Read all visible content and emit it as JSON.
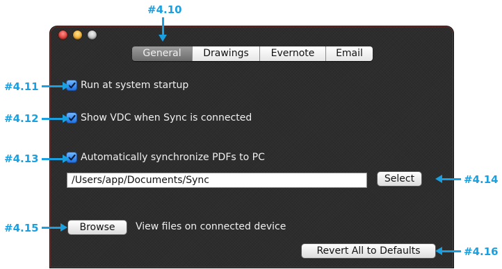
{
  "window": {
    "controls": [
      "close-icon",
      "minimize-icon",
      "zoom-icon"
    ]
  },
  "tabs": [
    {
      "label": "General",
      "active": true
    },
    {
      "label": "Drawings",
      "active": false
    },
    {
      "label": "Evernote",
      "active": false
    },
    {
      "label": "Email",
      "active": false
    }
  ],
  "settings": {
    "run_at_startup": {
      "label": "Run at system startup",
      "checked": true
    },
    "show_vdc": {
      "label": "Show VDC when Sync is connected",
      "checked": true
    },
    "auto_sync_pdfs": {
      "label": "Automatically synchronize PDFs to PC",
      "checked": true
    },
    "sync_path": {
      "value": "/Users/app/Documents/Sync"
    },
    "select_label": "Select",
    "browse_label": "Browse",
    "browse_description": "View files on connected device",
    "revert_label": "Revert All to Defaults"
  },
  "annotations": {
    "tabs": "#4.10",
    "run_at_startup": "#4.11",
    "show_vdc": "#4.12",
    "auto_sync": "#4.13",
    "select": "#4.14",
    "browse": "#4.15",
    "revert": "#4.16"
  },
  "colors": {
    "accent": "#1aa0e0",
    "window_bg": "#2d2d2d",
    "checkbox": "#1f72e6"
  }
}
